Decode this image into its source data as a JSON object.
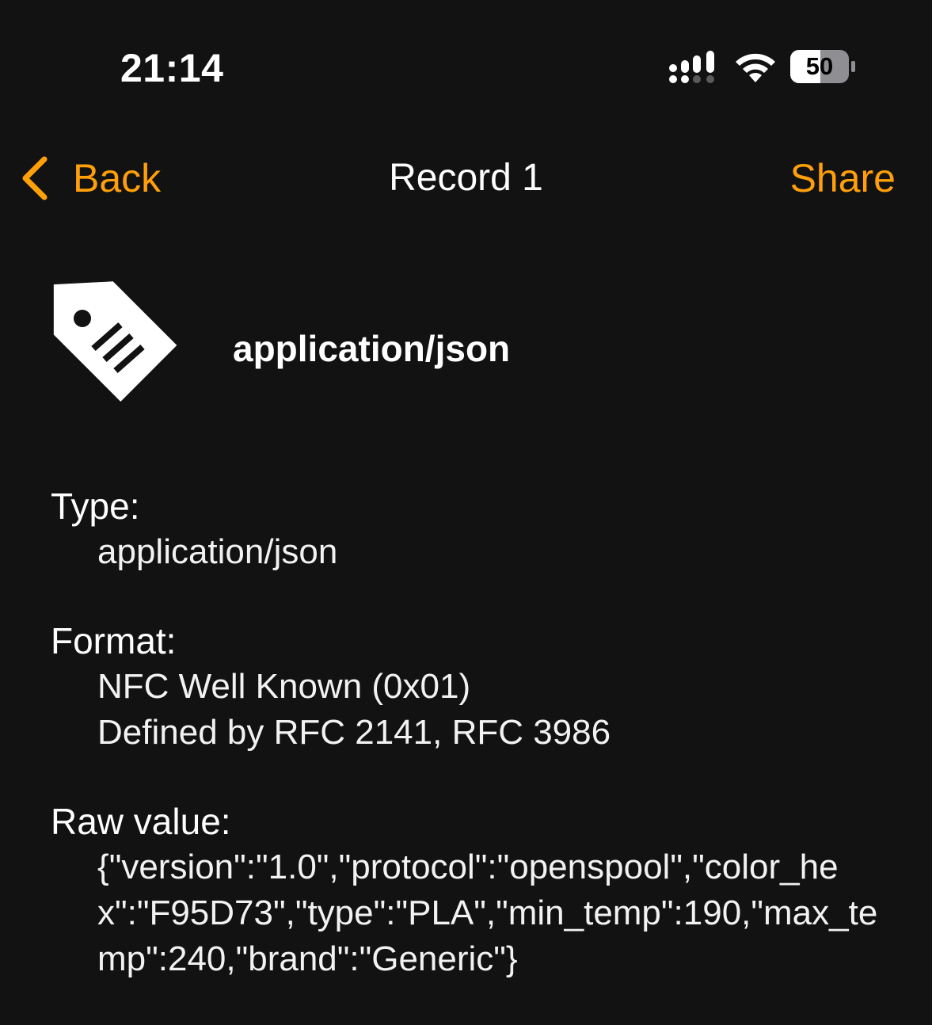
{
  "status_bar": {
    "time": "21:14",
    "battery": "50"
  },
  "nav": {
    "back_label": "Back",
    "title": "Record 1",
    "share_label": "Share"
  },
  "record": {
    "title": "application/json"
  },
  "details": {
    "type_label": "Type:",
    "type_value": "application/json",
    "format_label": "Format:",
    "format_value_line1": "NFC Well Known (0x01)",
    "format_value_line2": "Defined by RFC 2141, RFC 3986",
    "raw_label": "Raw value:",
    "raw_value": "{\"version\":\"1.0\",\"protocol\":\"openspool\",\"color_hex\":\"F95D73\",\"type\":\"PLA\",\"min_temp\":190,\"max_temp\":240,\"brand\":\"Generic\"}"
  },
  "colors": {
    "background": "#121212",
    "accent": "#ff9f0a",
    "text": "#ffffff"
  },
  "icons": {
    "back": "chevron-left-icon",
    "tag": "tag-icon",
    "signal": "signal-icon",
    "wifi": "wifi-icon",
    "battery": "battery-icon"
  }
}
